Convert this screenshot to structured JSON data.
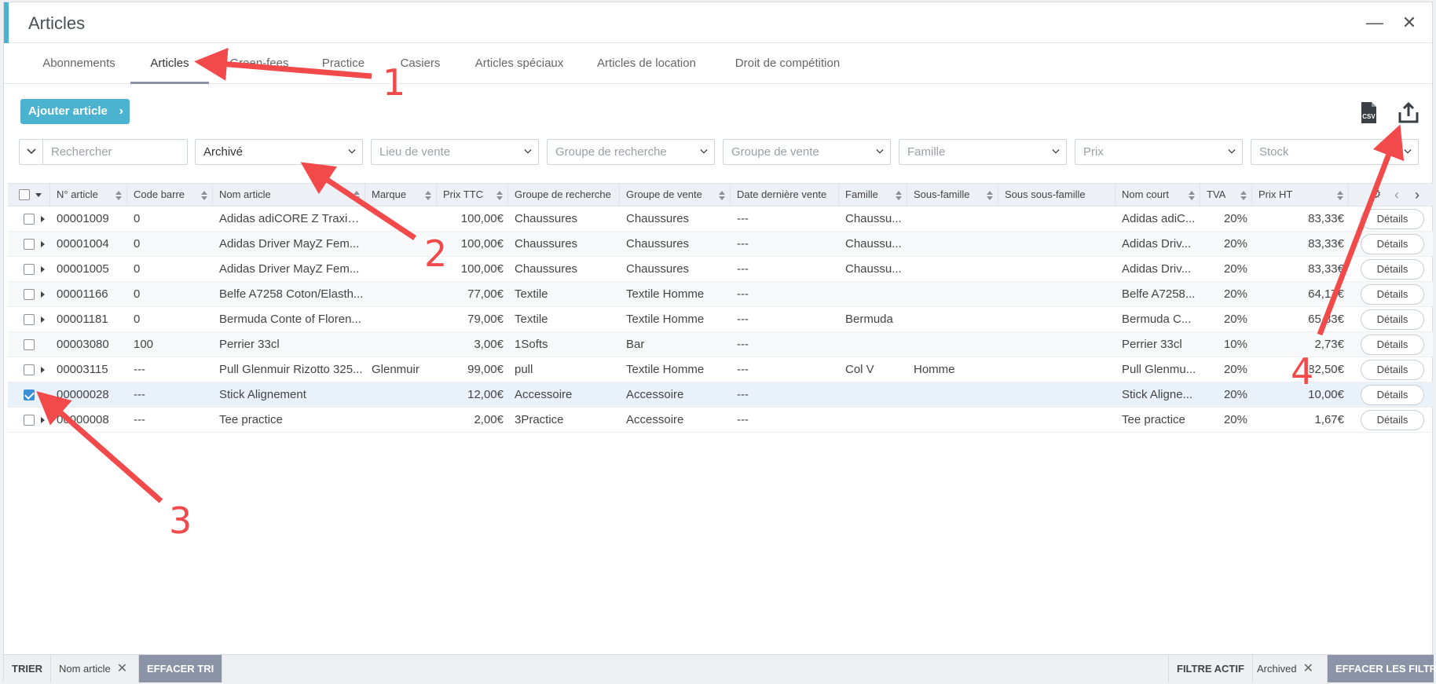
{
  "window": {
    "title": "Articles"
  },
  "tabs": [
    {
      "label": "Abonnements",
      "active": false
    },
    {
      "label": "Articles",
      "active": true
    },
    {
      "label": "Green-fees",
      "active": false
    },
    {
      "label": "Practice",
      "active": false
    },
    {
      "label": "Casiers",
      "active": false
    },
    {
      "label": "Articles spéciaux",
      "active": false
    },
    {
      "label": "Articles de location",
      "active": false
    },
    {
      "label": "Droit de compétition",
      "active": false
    }
  ],
  "toolbar": {
    "add_label": "Ajouter article",
    "csv_icon": "csv-icon",
    "export_icon": "export-icon"
  },
  "filters": {
    "search_placeholder": "Rechercher",
    "archive_value": "Archivé",
    "lieu_placeholder": "Lieu de vente",
    "groupe_recherche_placeholder": "Groupe de recherche",
    "groupe_vente_placeholder": "Groupe de vente",
    "famille_placeholder": "Famille",
    "prix_placeholder": "Prix",
    "stock_placeholder": "Stock"
  },
  "columns": [
    "N° article",
    "Code barre",
    "Nom article",
    "Marque",
    "Prix TTC",
    "Groupe de recherche",
    "Groupe de vente",
    "Date dernière vente",
    "Famille",
    "Sous-famille",
    "Sous sous-famille",
    "Nom court",
    "TVA",
    "Prix HT"
  ],
  "rows": [
    {
      "checked": false,
      "expandable": true,
      "no": "00001009",
      "code": "0",
      "nom": "Adidas adiCORE Z Traxion...",
      "marque": "",
      "ttc": "100,00€",
      "grech": "Chaussures",
      "gvente": "Chaussures",
      "date": "---",
      "famille": "Chaussu...",
      "sfam": "",
      "ssfam": "",
      "court": "Adidas adiC...",
      "tva": "20%",
      "ht": "83,33€",
      "details": "Détails"
    },
    {
      "checked": false,
      "expandable": true,
      "no": "00001004",
      "code": "0",
      "nom": "Adidas Driver MayZ Fem...",
      "marque": "",
      "ttc": "100,00€",
      "grech": "Chaussures",
      "gvente": "Chaussures",
      "date": "---",
      "famille": "Chaussu...",
      "sfam": "",
      "ssfam": "",
      "court": "Adidas Driv...",
      "tva": "20%",
      "ht": "83,33€",
      "details": "Détails"
    },
    {
      "checked": false,
      "expandable": true,
      "no": "00001005",
      "code": "0",
      "nom": "Adidas Driver MayZ Fem...",
      "marque": "",
      "ttc": "100,00€",
      "grech": "Chaussures",
      "gvente": "Chaussures",
      "date": "---",
      "famille": "Chaussu...",
      "sfam": "",
      "ssfam": "",
      "court": "Adidas Driv...",
      "tva": "20%",
      "ht": "83,33€",
      "details": "Détails"
    },
    {
      "checked": false,
      "expandable": true,
      "no": "00001166",
      "code": "0",
      "nom": "Belfe A7258 Coton/Elasth...",
      "marque": "",
      "ttc": "77,00€",
      "grech": "Textile",
      "gvente": "Textile Homme",
      "date": "---",
      "famille": "",
      "sfam": "",
      "ssfam": "",
      "court": "Belfe A7258...",
      "tva": "20%",
      "ht": "64,17€",
      "details": "Détails"
    },
    {
      "checked": false,
      "expandable": true,
      "no": "00001181",
      "code": "0",
      "nom": "Bermuda Conte of Floren...",
      "marque": "",
      "ttc": "79,00€",
      "grech": "Textile",
      "gvente": "Textile Homme",
      "date": "---",
      "famille": "Bermuda",
      "sfam": "",
      "ssfam": "",
      "court": "Bermuda C...",
      "tva": "20%",
      "ht": "65,83€",
      "details": "Détails"
    },
    {
      "checked": false,
      "expandable": false,
      "no": "00003080",
      "code": "100",
      "nom": "Perrier 33cl",
      "marque": "",
      "ttc": "3,00€",
      "grech": "1Softs",
      "gvente": "Bar",
      "date": "---",
      "famille": "",
      "sfam": "",
      "ssfam": "",
      "court": "Perrier 33cl",
      "tva": "10%",
      "ht": "2,73€",
      "details": "Détails"
    },
    {
      "checked": false,
      "expandable": true,
      "no": "00003115",
      "code": "---",
      "nom": "Pull Glenmuir Rizotto 325...",
      "marque": "Glenmuir",
      "ttc": "99,00€",
      "grech": "pull",
      "gvente": "Textile Homme",
      "date": "---",
      "famille": "Col V",
      "sfam": "Homme",
      "ssfam": "",
      "court": "Pull Glenmu...",
      "tva": "20%",
      "ht": "82,50€",
      "details": "Détails"
    },
    {
      "checked": true,
      "expandable": false,
      "no": "00000028",
      "code": "---",
      "nom": "Stick Alignement",
      "marque": "",
      "ttc": "12,00€",
      "grech": "Accessoire",
      "gvente": "Accessoire",
      "date": "---",
      "famille": "",
      "sfam": "",
      "ssfam": "",
      "court": "Stick Aligne...",
      "tva": "20%",
      "ht": "10,00€",
      "details": "Détails"
    },
    {
      "checked": false,
      "expandable": true,
      "no": "00000008",
      "code": "---",
      "nom": "Tee practice",
      "marque": "",
      "ttc": "2,00€",
      "grech": "3Practice",
      "gvente": "Accessoire",
      "date": "---",
      "famille": "",
      "sfam": "",
      "ssfam": "",
      "court": "Tee practice",
      "tva": "20%",
      "ht": "1,67€",
      "details": "Détails"
    }
  ],
  "footer": {
    "sort_label": "TRIER",
    "sort_value": "Nom article",
    "clear_sort": "EFFACER TRI",
    "filter_label": "FILTRE ACTIF",
    "filter_value": "Archived",
    "clear_filters": "EFFACER LES FILTRES"
  },
  "annotations": [
    "1",
    "2",
    "3",
    "4"
  ],
  "colors": {
    "accent": "#4bb3cf",
    "annotation": "#f24a4a",
    "footer_button": "#8b93a6",
    "checked": "#3a8fd6"
  }
}
